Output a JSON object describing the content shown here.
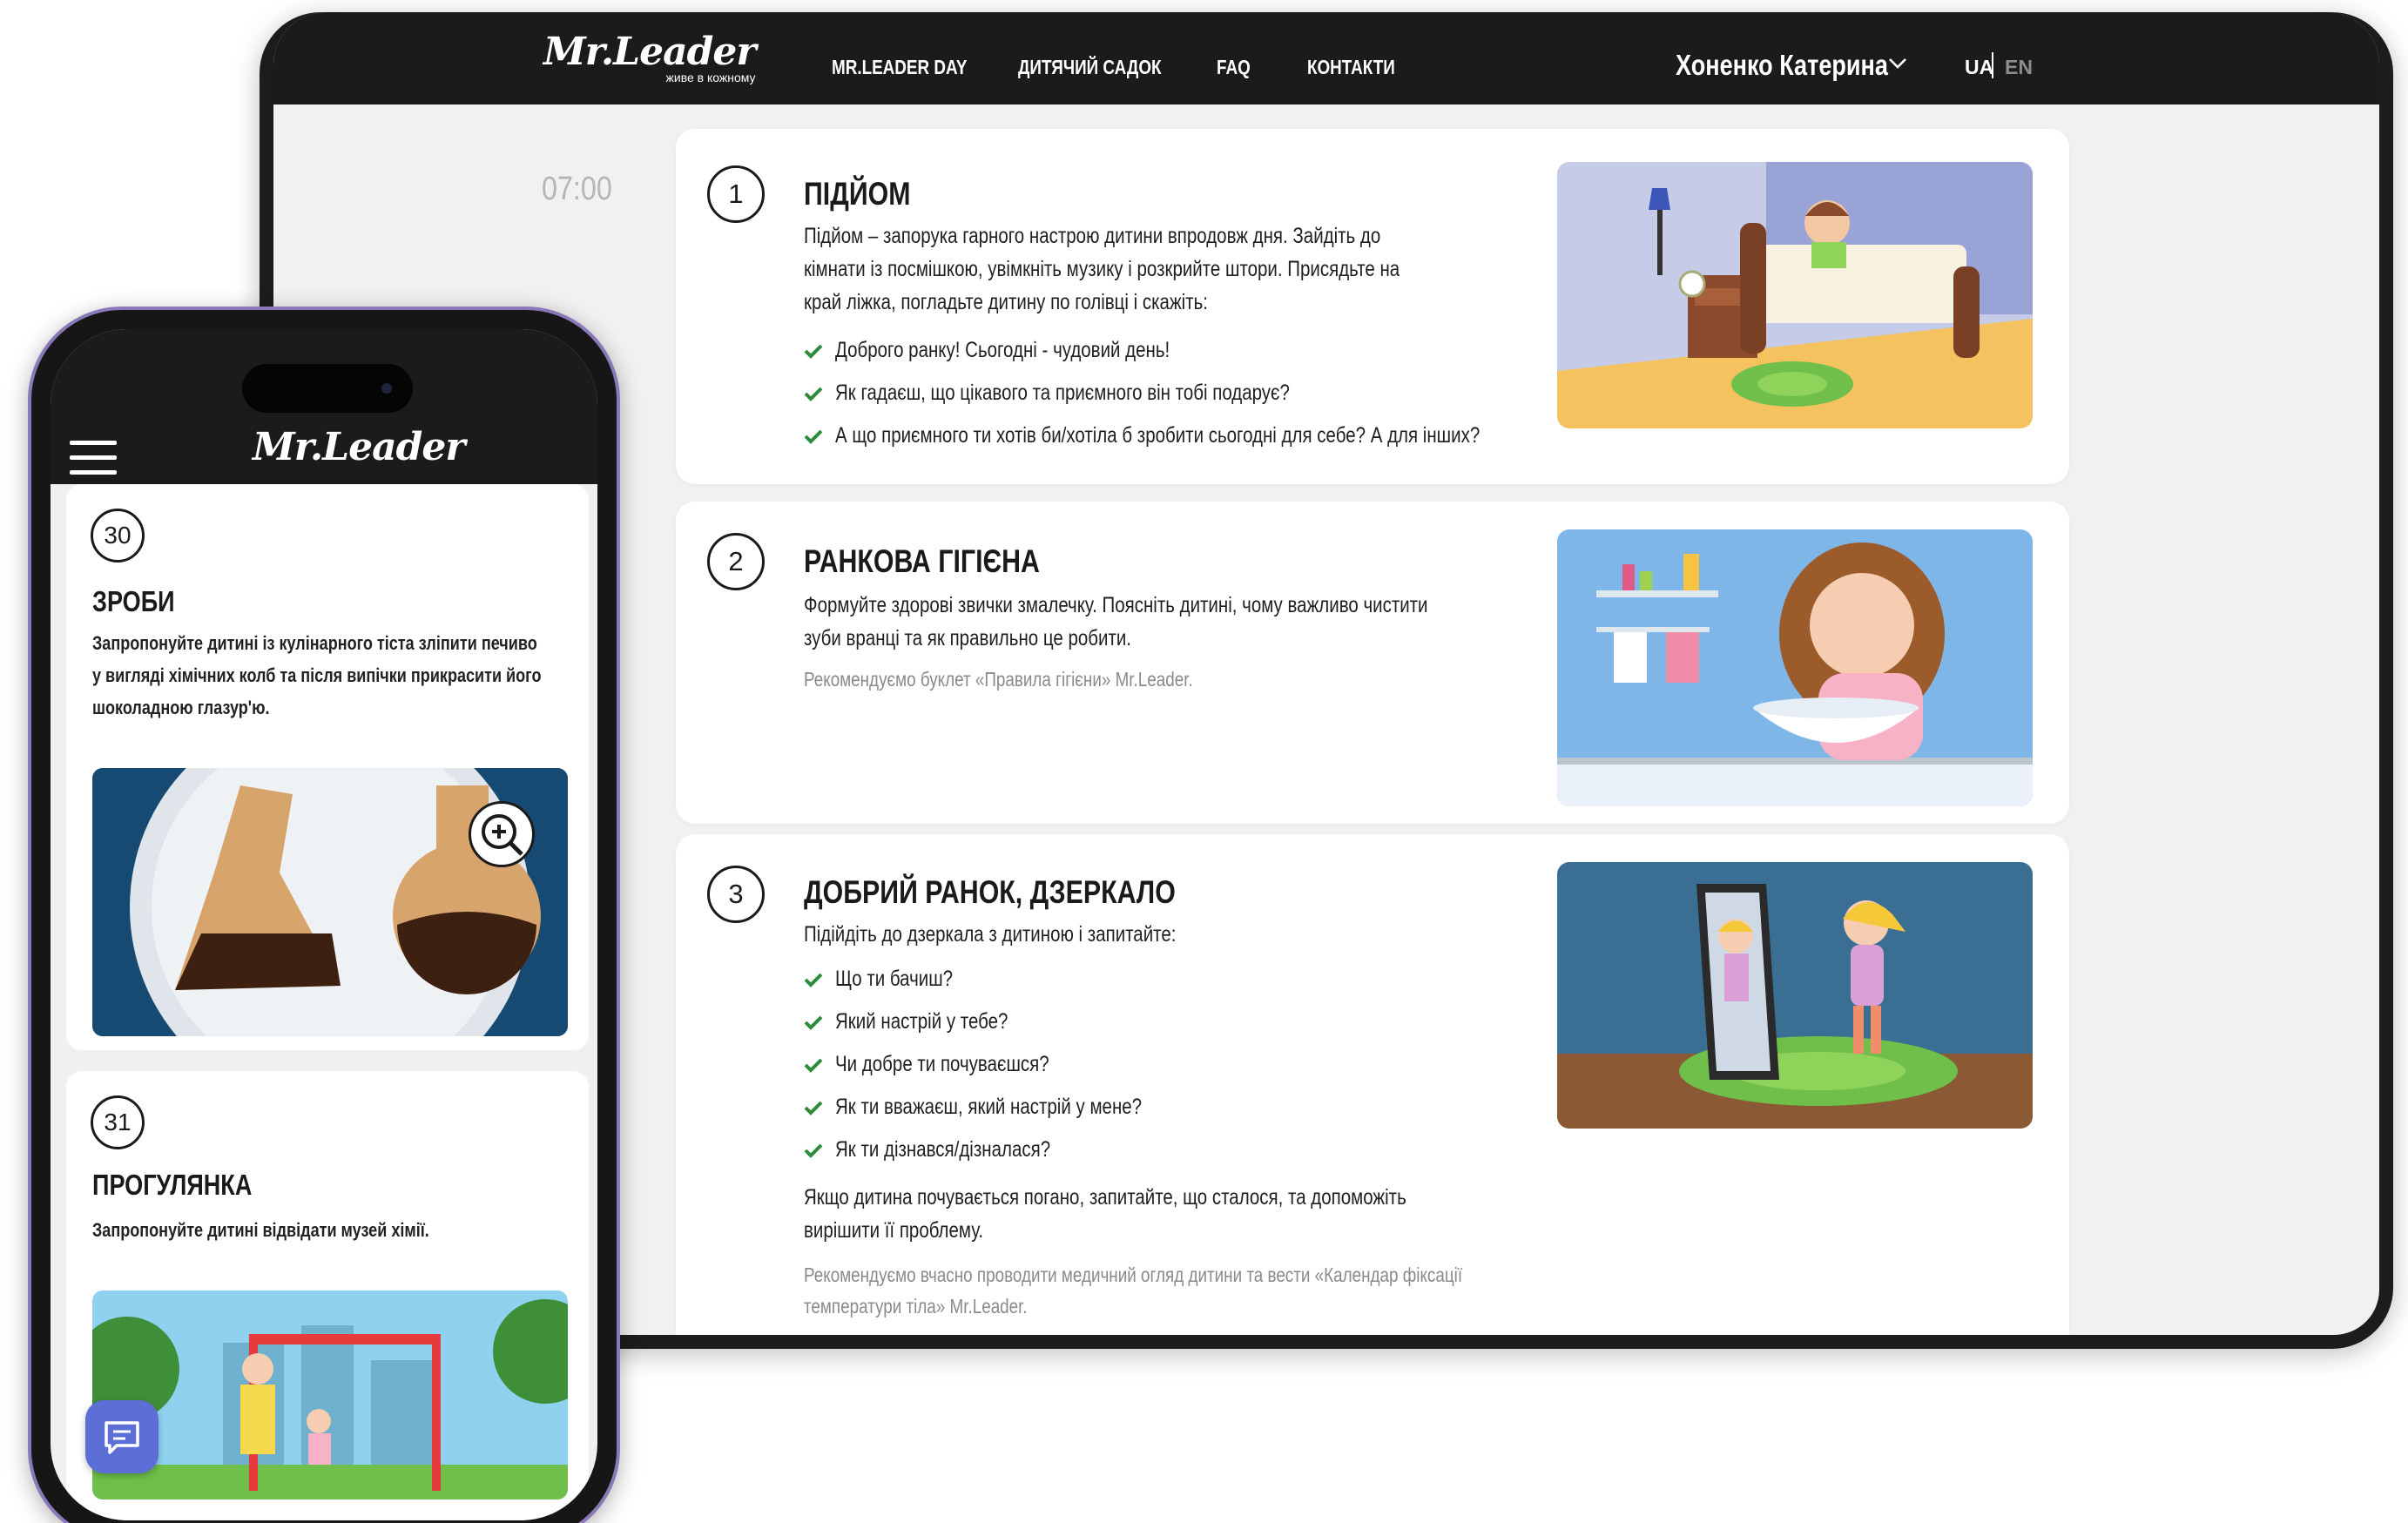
{
  "tablet": {
    "header": {
      "logo_text": "Mr.Leader",
      "logo_tagline": "живе в кожному",
      "nav": [
        "MR.LEADER DAY",
        "ДИТЯЧИЙ САДОК",
        "FAQ",
        "КОНТАКТИ"
      ],
      "user_name": "Хоненко Катерина",
      "lang_active": "UA",
      "lang_other": "EN"
    },
    "time": "07:00",
    "cards": [
      {
        "number": "1",
        "title": "ПІДЙОМ",
        "text": "Підйом – запорука гарного настрою дитини впродовж дня. Зайдіть до кімнати із посмішкою, увімкніть музику і розкрийте штори. Присядьте на край ліжка, погладьте дитину по голівці і скажіть:",
        "checklist": [
          "Доброго ранку! Сьогодні - чудовий день!",
          "Як гадаєш, що цікавого та приємного він тобі подарує?",
          "А що приємного ти хотів би/хотіла б зробити сьогодні для себе? А для інших?"
        ]
      },
      {
        "number": "2",
        "title": "РАНКОВА ГІГІЄНА",
        "text": "Формуйте здорові звички змалечку. Поясніть дитині, чому важливо чистити зуби вранці та як правильно це робити.",
        "recommendation": "Рекомендуємо буклет «Правила гігієни» Mr.Leader."
      },
      {
        "number": "3",
        "title": "ДОБРИЙ РАНОК, ДЗЕРКАЛО",
        "text": "Підійдіть до дзеркала з дитиною і запитайте:",
        "checklist": [
          "Що ти бачиш?",
          "Який настрій у тебе?",
          "Чи добре ти почуваєшся?",
          "Як ти вважаєш, який настрій у мене?",
          "Як ти дізнався/дізналася?"
        ],
        "after_text": "Якщо дитина почувається погано, запитайте, що сталося, та допоможіть вирішити її проблему.",
        "recommendation": "Рекомендуємо вчасно проводити медичний огляд дитини та вести «Календар фіксації температури тіла» Mr.Leader."
      }
    ]
  },
  "phone": {
    "logo_text": "Mr.Leader",
    "cards": [
      {
        "number": "30",
        "title": "ЗРОБИ",
        "text": "Запропонуйте дитині із кулінарного тіста зліпити печиво у вигляді хімічних колб та після випічки прикрасити його шоколадною глазур'ю."
      },
      {
        "number": "31",
        "title": "ПРОГУЛЯНКА",
        "text": "Запропонуйте дитині відвідати музей хімії."
      }
    ]
  },
  "colors": {
    "header_bg": "#1b1b1b",
    "check_green": "#2e8b3a",
    "page_bg": "#f1f1f1",
    "phone_frame": "#8a78b8",
    "chat_button": "#5d6fd6"
  },
  "icons": [
    "chevron-down-icon",
    "check-icon",
    "menu-icon",
    "zoom-in-icon",
    "chat-icon"
  ]
}
